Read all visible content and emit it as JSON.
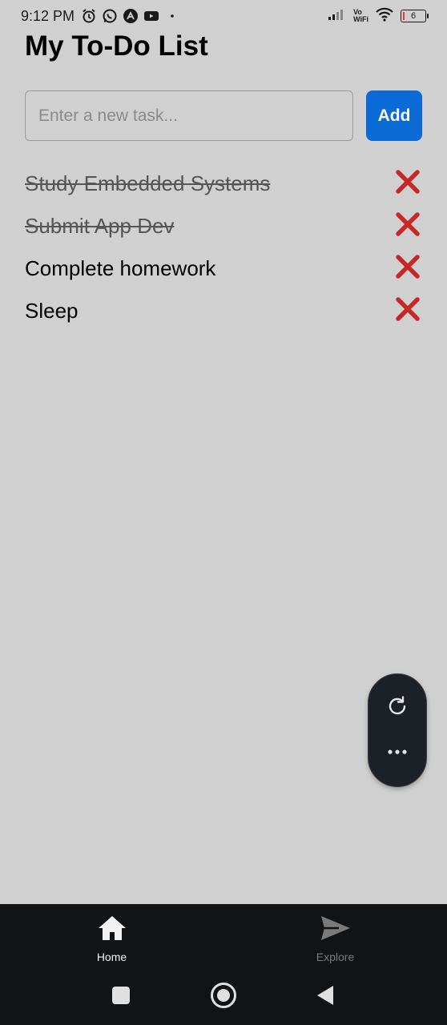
{
  "status_bar": {
    "time": "9:12 PM",
    "vowifi_top": "Vo",
    "vowifi_bottom": "WiFi",
    "battery": "6"
  },
  "header": {
    "title": "My To-Do List"
  },
  "new_task": {
    "placeholder": "Enter a new task...",
    "value": "",
    "add_label": "Add"
  },
  "tasks": [
    {
      "text": "Study Embedded Systems",
      "completed": true
    },
    {
      "text": "Submit App Dev",
      "completed": true
    },
    {
      "text": "Complete homework",
      "completed": false
    },
    {
      "text": "Sleep",
      "completed": false
    }
  ],
  "bottom_nav": {
    "items": [
      {
        "label": "Home",
        "icon": "home-icon",
        "active": true
      },
      {
        "label": "Explore",
        "icon": "send-icon",
        "active": false
      }
    ]
  },
  "colors": {
    "background": "#d0d0d0",
    "accent": "#0b6bd6",
    "delete": "#c62828",
    "nav_bg": "#111315"
  }
}
